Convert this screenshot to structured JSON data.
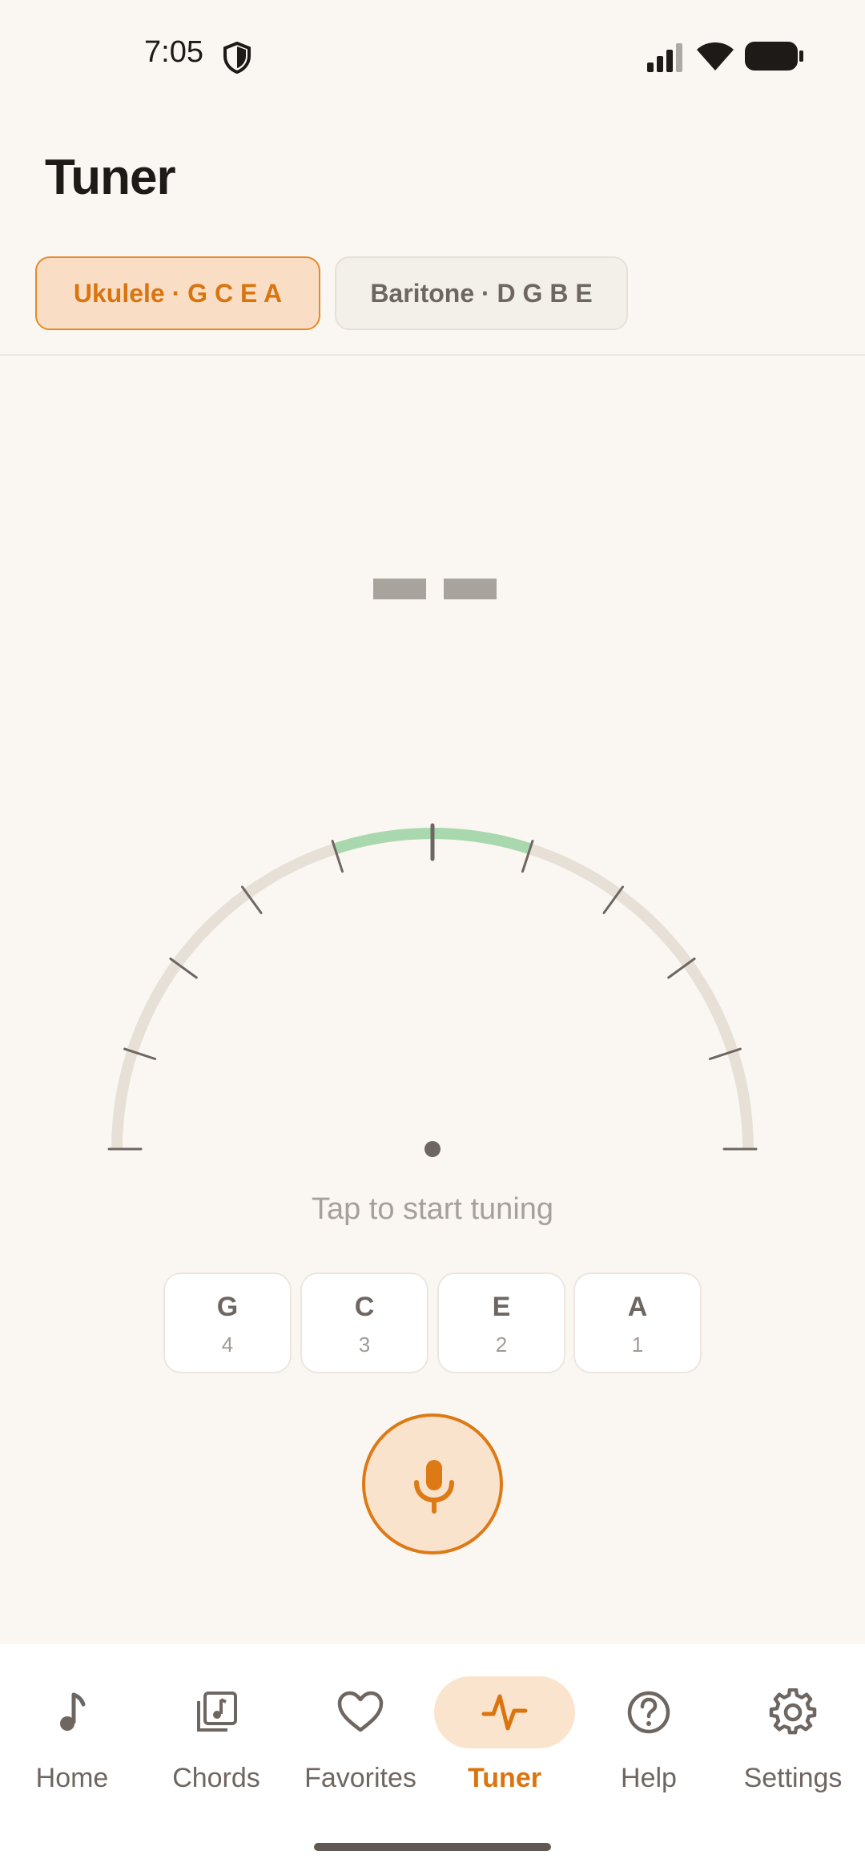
{
  "status": {
    "time": "7:05",
    "icons": [
      "shield-icon",
      "signal-icon",
      "wifi-icon",
      "battery-icon"
    ]
  },
  "header": {
    "title": "Tuner"
  },
  "tuning_chips": [
    {
      "label": "Ukulele · G C E A",
      "selected": true
    },
    {
      "label": "Baritone · D G B E",
      "selected": false
    }
  ],
  "tuner": {
    "note_display": "— —",
    "hint": "Tap to start tuning",
    "strings": [
      {
        "note": "G",
        "number": "4"
      },
      {
        "note": "C",
        "number": "3"
      },
      {
        "note": "E",
        "number": "2"
      },
      {
        "note": "A",
        "number": "1"
      }
    ],
    "mic_icon": "microphone-icon"
  },
  "colors": {
    "accent": "#D9740F",
    "accent_soft": "#F9DEC5",
    "in_tune_zone": "#A9D8AE",
    "gauge_track": "#E7E0D7",
    "background": "#FAF7F2"
  },
  "nav": {
    "items": [
      {
        "label": "Home",
        "icon": "music-note-icon",
        "active": false
      },
      {
        "label": "Chords",
        "icon": "music-library-icon",
        "active": false
      },
      {
        "label": "Favorites",
        "icon": "heart-icon",
        "active": false
      },
      {
        "label": "Tuner",
        "icon": "waveform-icon",
        "active": true
      },
      {
        "label": "Help",
        "icon": "help-circle-icon",
        "active": false
      },
      {
        "label": "Settings",
        "icon": "gear-icon",
        "active": false
      }
    ]
  }
}
